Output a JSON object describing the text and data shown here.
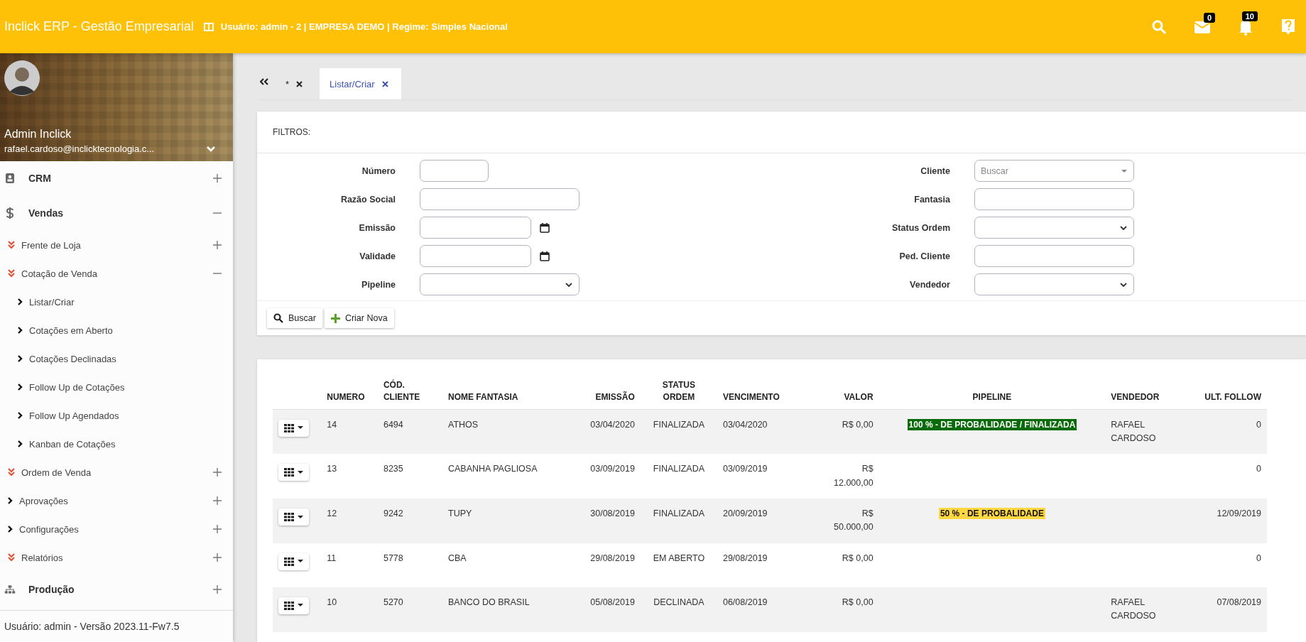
{
  "topbar": {
    "title": "Inclick ERP - Gestão Empresarial",
    "session": "Usuário: admin - 2 | EMPRESA DEMO | Regime: Simples Nacional",
    "messages_badge": "0",
    "notifications_badge": "10"
  },
  "user": {
    "name": "Admin Inclick",
    "email": "rafael.cardoso@inclicktecnologia.c..."
  },
  "sidebar": {
    "items": [
      {
        "label": "CRM",
        "kind": "module",
        "expanded": false
      },
      {
        "label": "Vendas",
        "kind": "module",
        "expanded": true,
        "children": [
          {
            "label": "Frente de Loja",
            "kind": "double",
            "expanded": false
          },
          {
            "label": "Cotação de Venda",
            "kind": "double",
            "expanded": true,
            "children": [
              {
                "label": "Listar/Criar",
                "kind": "single"
              },
              {
                "label": "Cotações em Aberto",
                "kind": "single"
              },
              {
                "label": "Cotações Declinadas",
                "kind": "single"
              },
              {
                "label": "Follow Up de Cotações",
                "kind": "single"
              },
              {
                "label": "Follow Up Agendados",
                "kind": "single"
              },
              {
                "label": "Kanban de Cotações",
                "kind": "single"
              }
            ]
          },
          {
            "label": "Ordem de Venda",
            "kind": "double",
            "expanded": false
          },
          {
            "label": "Aprovações",
            "kind": "single",
            "expanded": false
          },
          {
            "label": "Configurações",
            "kind": "single",
            "expanded": false
          },
          {
            "label": "Relatórios",
            "kind": "double",
            "expanded": false
          }
        ]
      },
      {
        "label": "Produção",
        "kind": "module",
        "expanded": false
      }
    ],
    "footer": "Usuário: admin - Versão 2023.11-Fw7.5"
  },
  "tabs": [
    {
      "label": "*",
      "selected": false
    },
    {
      "label": "Listar/Criar",
      "selected": true
    }
  ],
  "filters": {
    "title": "FILTROS:",
    "left": [
      {
        "label": "Número",
        "kind": "short"
      },
      {
        "label": "Razão Social",
        "kind": "text"
      },
      {
        "label": "Emissão",
        "kind": "date"
      },
      {
        "label": "Validade",
        "kind": "date"
      },
      {
        "label": "Pipeline",
        "kind": "select"
      }
    ],
    "right": [
      {
        "label": "Cliente",
        "kind": "search",
        "placeholder": "Buscar"
      },
      {
        "label": "Fantasia",
        "kind": "text"
      },
      {
        "label": "Status Ordem",
        "kind": "select"
      },
      {
        "label": "Ped. Cliente",
        "kind": "text"
      },
      {
        "label": "Vendedor",
        "kind": "select"
      }
    ],
    "buttons": [
      {
        "label": "Buscar",
        "kind": "search"
      },
      {
        "label": "Criar Nova",
        "kind": "add"
      }
    ]
  },
  "table": {
    "columns": [
      "NUMERO",
      "CÓD. CLIENTE",
      "NOME FANTASIA",
      "EMISSÃO",
      "STATUS ORDEM",
      "VENCIMENTO",
      "VALOR",
      "PIPELINE",
      "VENDEDOR",
      "ULT. FOLLOW"
    ],
    "rows": [
      {
        "numero": "14",
        "cod": "6494",
        "nome": "ATHOS",
        "emissao": "03/04/2020",
        "status": "FINALIZADA",
        "vencimento": "03/04/2020",
        "valor": "R$ 0,00",
        "pipeline": {
          "text": "100 % - DE PROBALIDADE / FINALIZADA",
          "color": "#0a6b0a"
        },
        "vendedor": "RAFAEL CARDOSO",
        "follow": "0"
      },
      {
        "numero": "13",
        "cod": "8235",
        "nome": "CABANHA PAGLIOSA",
        "emissao": "03/09/2019",
        "status": "FINALIZADA",
        "vencimento": "03/09/2019",
        "valor": "R$ 12.000,00",
        "follow": "0"
      },
      {
        "numero": "12",
        "cod": "9242",
        "nome": "TUPY",
        "emissao": "30/08/2019",
        "status": "FINALIZADA",
        "vencimento": "20/09/2019",
        "valor": "R$ 50.000,00",
        "pipeline": {
          "text": "50 % - DE PROBALIDADE",
          "color": "#ffd740"
        },
        "follow": "12/09/2019"
      },
      {
        "numero": "11",
        "cod": "5778",
        "nome": "CBA",
        "emissao": "29/08/2019",
        "status": "EM ABERTO",
        "vencimento": "29/08/2019",
        "valor": "R$ 0,00",
        "follow": "0"
      },
      {
        "numero": "10",
        "cod": "5270",
        "nome": "BANCO DO BRASIL",
        "emissao": "05/08/2019",
        "status": "DECLINADA",
        "vencimento": "06/08/2019",
        "valor": "R$ 0,00",
        "vendedor": "RAFAEL CARDOSO",
        "follow": "07/08/2019"
      }
    ]
  }
}
